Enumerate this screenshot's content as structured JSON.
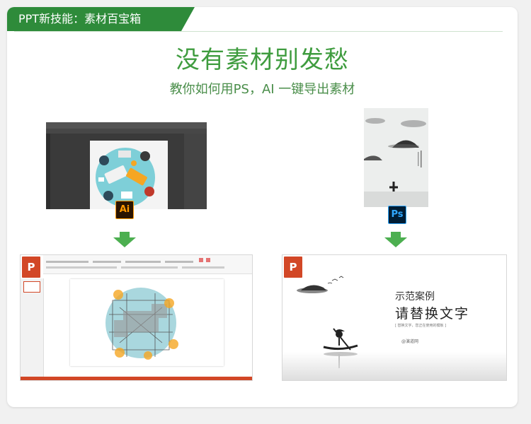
{
  "ribbon": {
    "label": "PPT新技能：素材百宝箱"
  },
  "headline": {
    "title": "没有素材别发愁",
    "subtitle": "教你如何用PS，AI 一键导出素材"
  },
  "badges": {
    "ai": "Ai",
    "ps": "Ps",
    "ppt": "P"
  },
  "sample_slide": {
    "title": "示范案例",
    "main": "请替换文字",
    "caption": "[ 替换文字，您正在使用的模板 ]",
    "signature": "@演道网"
  },
  "colors": {
    "brand_green": "#3f9c3f",
    "ribbon_green": "#2e8b3a",
    "arrow_green": "#4caf50",
    "ppt_orange": "#d24726",
    "ai_orange": "#ff9a00",
    "ps_blue": "#31a8ff"
  }
}
